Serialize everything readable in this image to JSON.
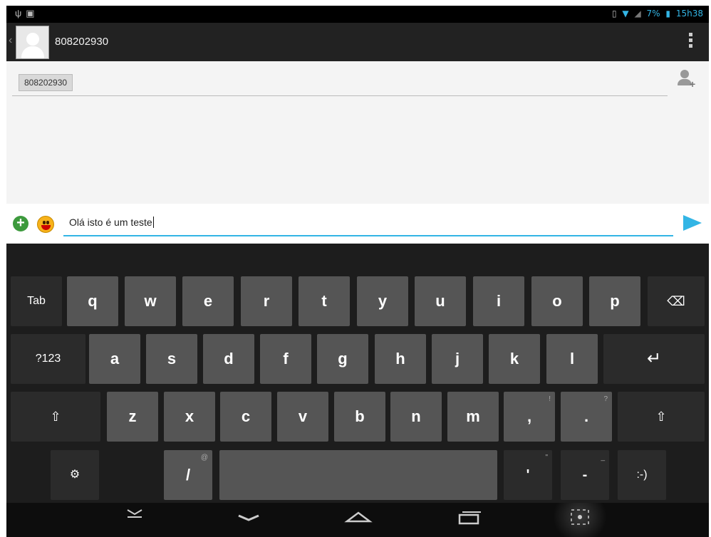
{
  "status_bar": {
    "left_icons": [
      "usb-icon",
      "image-icon"
    ],
    "battery_percent": "7%",
    "time": "15h38"
  },
  "header": {
    "contact_name": "808202930",
    "icons": [
      "back-chevron-icon",
      "contact-avatar-icon",
      "overflow-menu-icon"
    ]
  },
  "recipients": {
    "chip_label": "808202930",
    "add_contact_icon": "add-contact-icon"
  },
  "compose": {
    "message_text": "Olá isto é um teste",
    "icons": [
      "attach-add-icon",
      "emoji-smiley-icon",
      "send-icon"
    ],
    "accent_color": "#33b5e5"
  },
  "keyboard": {
    "row1": [
      "Tab",
      "q",
      "w",
      "e",
      "r",
      "t",
      "y",
      "u",
      "i",
      "o",
      "p",
      "⌫"
    ],
    "row2": [
      "?123",
      "a",
      "s",
      "d",
      "f",
      "g",
      "h",
      "j",
      "k",
      "l",
      "↵"
    ],
    "row3": [
      "⇧",
      "z",
      "x",
      "c",
      "v",
      "b",
      "n",
      "m",
      ",",
      ".",
      "⇧"
    ],
    "row4": [
      "⚙",
      "/",
      "",
      "'",
      "-",
      ":-)"
    ],
    "hints": {
      "comma": "!",
      "period": "?",
      "slash": "@",
      "apostrophe": "\"",
      "dash": "_"
    }
  },
  "nav_bar": {
    "icons": [
      "hide-keyboard-icon",
      "back-icon",
      "home-icon",
      "recent-apps-icon",
      "screenshot-icon"
    ]
  }
}
